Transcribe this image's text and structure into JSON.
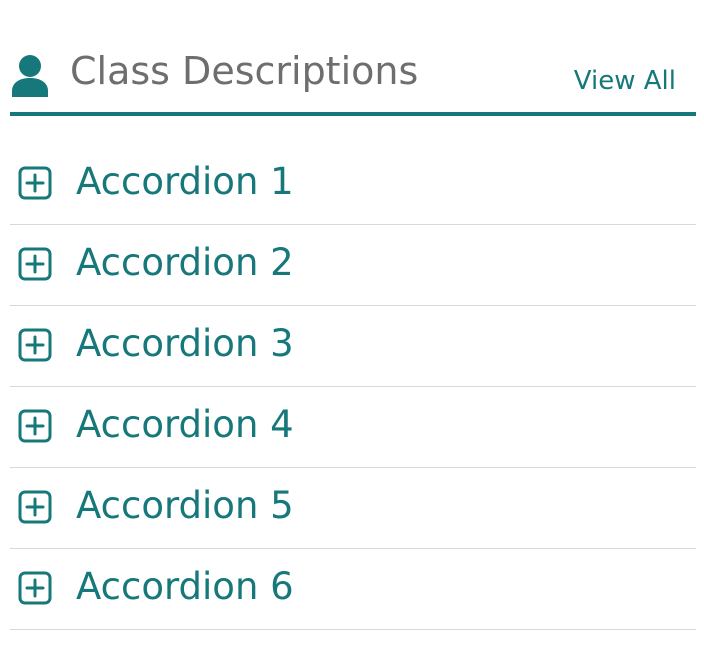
{
  "colors": {
    "accent": "#16787a",
    "title_text": "#6e6e6e",
    "divider": "#d9d9d9",
    "background": "#ffffff"
  },
  "header": {
    "icon": "person-icon",
    "title": "Class Descriptions",
    "view_all_label": "View All"
  },
  "accordions": [
    {
      "label": "Accordion 1",
      "icon": "plus-square-icon"
    },
    {
      "label": "Accordion 2",
      "icon": "plus-square-icon"
    },
    {
      "label": "Accordion 3",
      "icon": "plus-square-icon"
    },
    {
      "label": "Accordion 4",
      "icon": "plus-square-icon"
    },
    {
      "label": "Accordion 5",
      "icon": "plus-square-icon"
    },
    {
      "label": "Accordion 6",
      "icon": "plus-square-icon"
    }
  ]
}
